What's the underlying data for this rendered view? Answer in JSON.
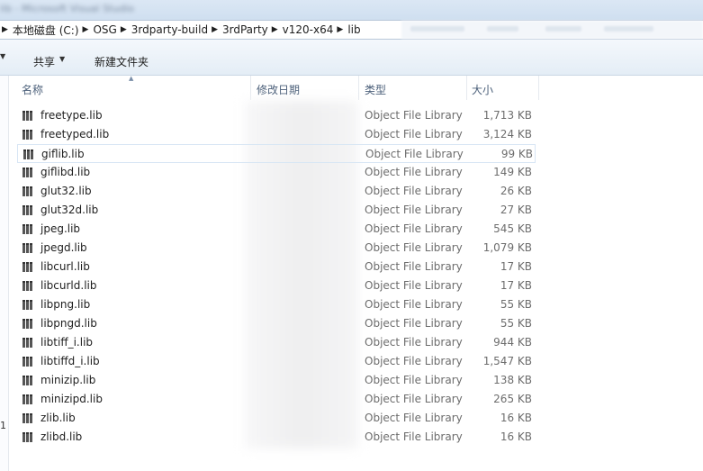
{
  "window": {
    "blurred_title": "lib - Microsoft Visual Studio"
  },
  "address": {
    "crumbs": [
      "本地磁盘 (C:)",
      "OSG",
      "3rdparty-build",
      "3rdParty",
      "v120-x64",
      "lib"
    ]
  },
  "toolbar": {
    "share_label": "共享",
    "new_folder_label": "新建文件夹"
  },
  "nav": {
    "partial_number": "1"
  },
  "columns": {
    "name": "名称",
    "date": "修改日期",
    "type": "类型",
    "size": "大小"
  },
  "files": [
    {
      "name": "freetype.lib",
      "type": "Object File Library",
      "size": "1,713 KB"
    },
    {
      "name": "freetyped.lib",
      "type": "Object File Library",
      "size": "3,124 KB"
    },
    {
      "name": "giflib.lib",
      "type": "Object File Library",
      "size": "99 KB"
    },
    {
      "name": "giflibd.lib",
      "type": "Object File Library",
      "size": "149 KB"
    },
    {
      "name": "glut32.lib",
      "type": "Object File Library",
      "size": "26 KB"
    },
    {
      "name": "glut32d.lib",
      "type": "Object File Library",
      "size": "27 KB"
    },
    {
      "name": "jpeg.lib",
      "type": "Object File Library",
      "size": "545 KB"
    },
    {
      "name": "jpegd.lib",
      "type": "Object File Library",
      "size": "1,079 KB"
    },
    {
      "name": "libcurl.lib",
      "type": "Object File Library",
      "size": "17 KB"
    },
    {
      "name": "libcurld.lib",
      "type": "Object File Library",
      "size": "17 KB"
    },
    {
      "name": "libpng.lib",
      "type": "Object File Library",
      "size": "55 KB"
    },
    {
      "name": "libpngd.lib",
      "type": "Object File Library",
      "size": "55 KB"
    },
    {
      "name": "libtiff_i.lib",
      "type": "Object File Library",
      "size": "944 KB"
    },
    {
      "name": "libtiffd_i.lib",
      "type": "Object File Library",
      "size": "1,547 KB"
    },
    {
      "name": "minizip.lib",
      "type": "Object File Library",
      "size": "138 KB"
    },
    {
      "name": "minizipd.lib",
      "type": "Object File Library",
      "size": "265 KB"
    },
    {
      "name": "zlib.lib",
      "type": "Object File Library",
      "size": "16 KB"
    },
    {
      "name": "zlibd.lib",
      "type": "Object File Library",
      "size": "16 KB"
    }
  ],
  "selected_file": "giflib.lib",
  "icons": {
    "file": "library-file-icon",
    "crumb_separator": "chevron-right-icon",
    "sort": "sort-ascending-icon"
  },
  "colors": {
    "header_text": "#4c607a",
    "secondary_text": "#6d6d6d",
    "selection_border": "#d8e6f4"
  }
}
